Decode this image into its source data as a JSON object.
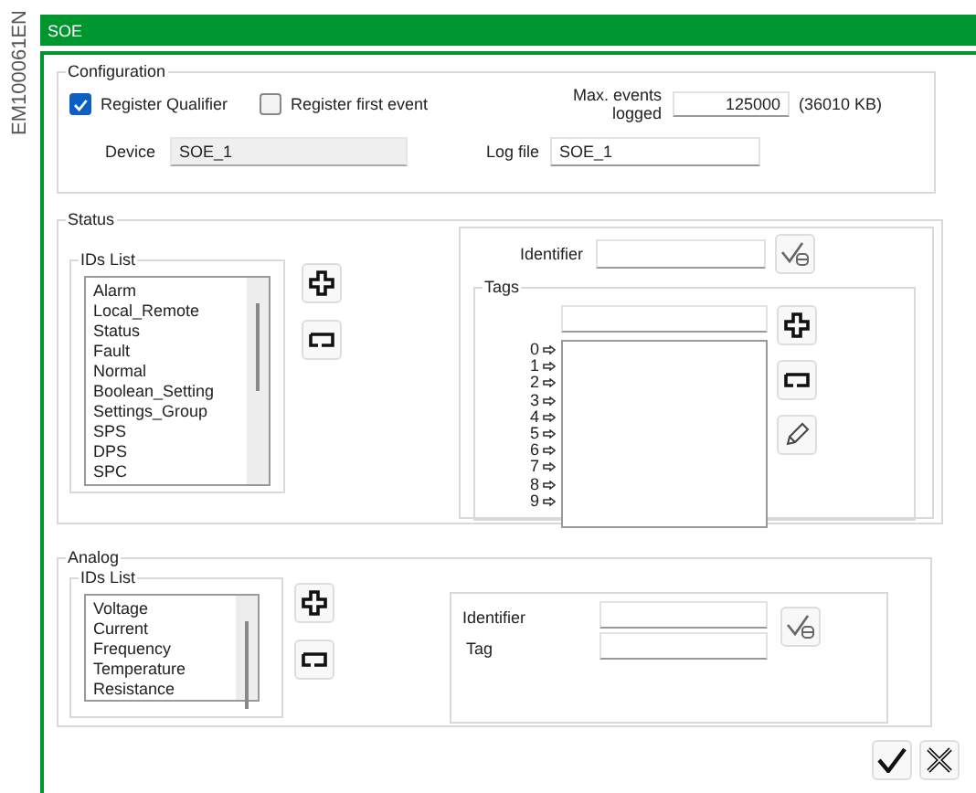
{
  "side_label": "EM100061EN",
  "window": {
    "title": "SOE"
  },
  "configuration": {
    "title": "Configuration",
    "register_qualifier": {
      "label": "Register Qualifier",
      "checked": true
    },
    "register_first_event": {
      "label": "Register first event",
      "checked": false
    },
    "max_events": {
      "label": "Max. events logged",
      "value": "125000",
      "size": "(36010 KB)"
    },
    "device": {
      "label": "Device",
      "value": "SOE_1",
      "disabled": true
    },
    "log_file": {
      "label": "Log file",
      "value": "SOE_1",
      "disabled": false
    }
  },
  "status": {
    "title": "Status",
    "ids_list": {
      "title": "IDs List",
      "items": [
        "Alarm",
        "Local_Remote",
        "Status",
        "Fault",
        "Normal",
        "Boolean_Setting",
        "Settings_Group",
        "SPS",
        "DPS",
        "SPC"
      ]
    },
    "identifier": {
      "label": "Identifier"
    },
    "tags": {
      "title": "Tags",
      "indices": [
        "0",
        "1",
        "2",
        "3",
        "4",
        "5",
        "6",
        "7",
        "8",
        "9"
      ]
    }
  },
  "analog": {
    "title": "Analog",
    "ids_list": {
      "title": "IDs List",
      "items": [
        "Voltage",
        "Current",
        "Frequency",
        "Temperature",
        "Resistance"
      ]
    },
    "identifier": {
      "label": "Identifier"
    },
    "tag": {
      "label": "Tag"
    }
  }
}
